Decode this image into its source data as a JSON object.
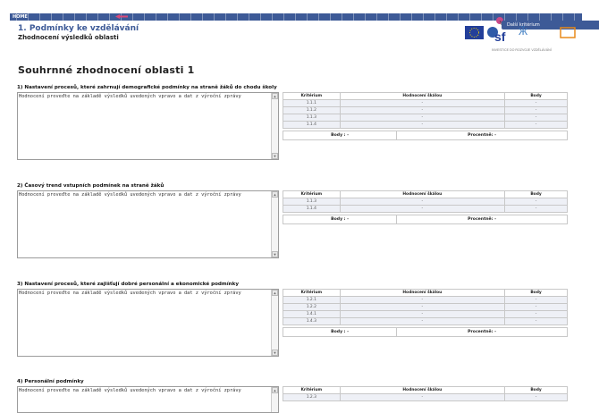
{
  "nav": {
    "home_label": "HOME",
    "next_tooltip": "Další kritérium"
  },
  "header": {
    "chapter": "1. Podmínky ke vzdělávání",
    "subtitle": "Zhodnocení výsledků oblasti"
  },
  "logos": {
    "tagline": "INVESTICE DO ROZVOJE VZDĚLÁVÁNÍ"
  },
  "page_title": "Souhrnné zhodnocení oblasti 1",
  "columns": {
    "criterion": "Kritérium",
    "rating": "Hodnocení škálou",
    "points": "Body"
  },
  "summary": {
    "points": "Body : -",
    "percent": "Procentně: -"
  },
  "sections": [
    {
      "title": "1) Nastavení procesů, které zahrnují demografické podmínky na straně žáků do chodu školy",
      "text": "Hodnocení proveďte na základě výsledků uvedených vpravo a dat z výroční zprávy",
      "rows": [
        {
          "criterion": "1.1.1",
          "rating": "-",
          "points": "-"
        },
        {
          "criterion": "1.1.2",
          "rating": "-",
          "points": "-"
        },
        {
          "criterion": "1.1.3",
          "rating": "-",
          "points": "-"
        },
        {
          "criterion": "1.1.4",
          "rating": "-",
          "points": "-"
        }
      ]
    },
    {
      "title": "2) Časový trend vstupních podmínek na straně žáků",
      "text": "Hodnocení proveďte na základě výsledků uvedených vpravo a dat z výroční zprávy",
      "rows": [
        {
          "criterion": "1.1.3",
          "rating": "-",
          "points": "-"
        },
        {
          "criterion": "1.1.4",
          "rating": "-",
          "points": "-"
        }
      ]
    },
    {
      "title": "3) Nastavení procesů, které zajišťují dobré personální a ekonomické podmínky",
      "text": "Hodnocení proveďte na základě výsledků uvedených vpravo a dat z výroční zprávy",
      "rows": [
        {
          "criterion": "1.2.1",
          "rating": "-",
          "points": "-"
        },
        {
          "criterion": "1.2.2",
          "rating": "-",
          "points": "-"
        },
        {
          "criterion": "1.4.1",
          "rating": "-",
          "points": "-"
        },
        {
          "criterion": "1.4.3",
          "rating": "-",
          "points": "-"
        }
      ]
    },
    {
      "title": "4) Personální podmínky",
      "text": "Hodnocení proveďte na základě výsledků uvedených vpravo a dat z výroční zprávy",
      "rows": [
        {
          "criterion": "1.2.3",
          "rating": "-",
          "points": "-"
        }
      ]
    }
  ]
}
